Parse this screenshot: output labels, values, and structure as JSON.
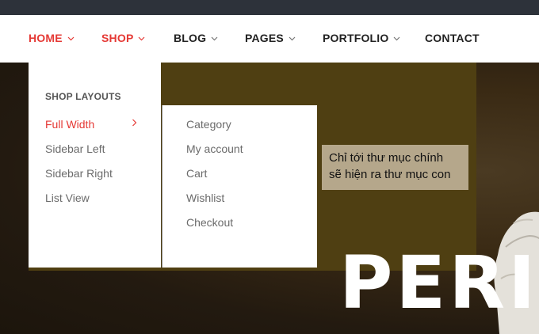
{
  "nav": {
    "items": [
      {
        "label": "HOME",
        "has_dropdown": true,
        "active": true
      },
      {
        "label": "SHOP",
        "has_dropdown": true,
        "active": true
      },
      {
        "label": "BLOG",
        "has_dropdown": true,
        "active": false
      },
      {
        "label": "PAGES",
        "has_dropdown": true,
        "active": false
      },
      {
        "label": "PORTFOLIO",
        "has_dropdown": true,
        "active": false
      },
      {
        "label": "CONTACT",
        "has_dropdown": false,
        "active": false
      }
    ]
  },
  "shop_menu": {
    "heading": "SHOP LAYOUTS",
    "items": [
      "Full Width",
      "Sidebar Left",
      "Sidebar Right",
      "List View"
    ],
    "active_item": "Full Width",
    "submenu": [
      "Category",
      "My account",
      "Cart",
      "Wishlist",
      "Checkout"
    ]
  },
  "tooltip": {
    "line1": "Chỉ tới thư mục chính",
    "line2": "sẽ hiện ra thư mục con"
  },
  "hero": {
    "title": "PERI"
  },
  "colors": {
    "accent": "#e53935",
    "topbar": "#2d323a",
    "overlay": "#4f3f12",
    "tooltip_bg": "#b5a78b"
  }
}
